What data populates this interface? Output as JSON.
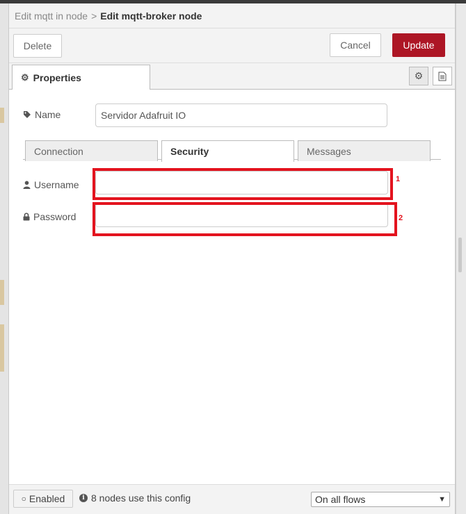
{
  "breadcrumb": {
    "parent": "Edit mqtt in node",
    "separator": ">",
    "current": "Edit mqtt-broker node"
  },
  "toolbar": {
    "delete_label": "Delete",
    "cancel_label": "Cancel",
    "update_label": "Update"
  },
  "tabs": {
    "properties_label": "Properties"
  },
  "form": {
    "name_label": "Name",
    "name_value": "Servidor Adafruit IO",
    "username_label": "Username",
    "username_value": "",
    "password_label": "Password",
    "password_value": ""
  },
  "subtabs": {
    "connection": "Connection",
    "security": "Security",
    "messages": "Messages",
    "active": "security"
  },
  "annotations": {
    "label_1": "1",
    "label_2": "2",
    "color": "#e3131e"
  },
  "footer": {
    "enabled_label": "Enabled",
    "users_info": "8 nodes use this config",
    "scope_selected": "On all flows"
  },
  "colors": {
    "accent": "#ad1625",
    "annotation": "#e3131e"
  },
  "icons": {
    "properties_tab": "gear-icon",
    "name": "tag-icon",
    "username": "user-icon",
    "password": "lock-icon",
    "info": "info-icon",
    "enabled": "circle-icon",
    "description_tab": "document-icon"
  }
}
